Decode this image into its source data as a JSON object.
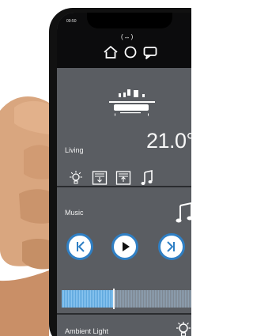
{
  "status": {
    "time": "09:50",
    "right": "..."
  },
  "nav": {
    "arrows": "(↔)"
  },
  "living": {
    "label": "Living",
    "temperature": "21.0°"
  },
  "music": {
    "label": "Music",
    "progress": 0.36
  },
  "ambient": {
    "label": "Ambient Light"
  },
  "colors": {
    "screen": "#5a5d62",
    "top": "#0c0c0d",
    "accent": "#2f7fc4",
    "progress": "#8ac5f0"
  },
  "icons": {
    "home": "home-icon",
    "circle": "circle-icon",
    "chat": "chat-icon",
    "light": "light-icon",
    "blind_down": "blind-down-icon",
    "blind_up": "blind-up-icon",
    "note": "music-note-icon"
  }
}
